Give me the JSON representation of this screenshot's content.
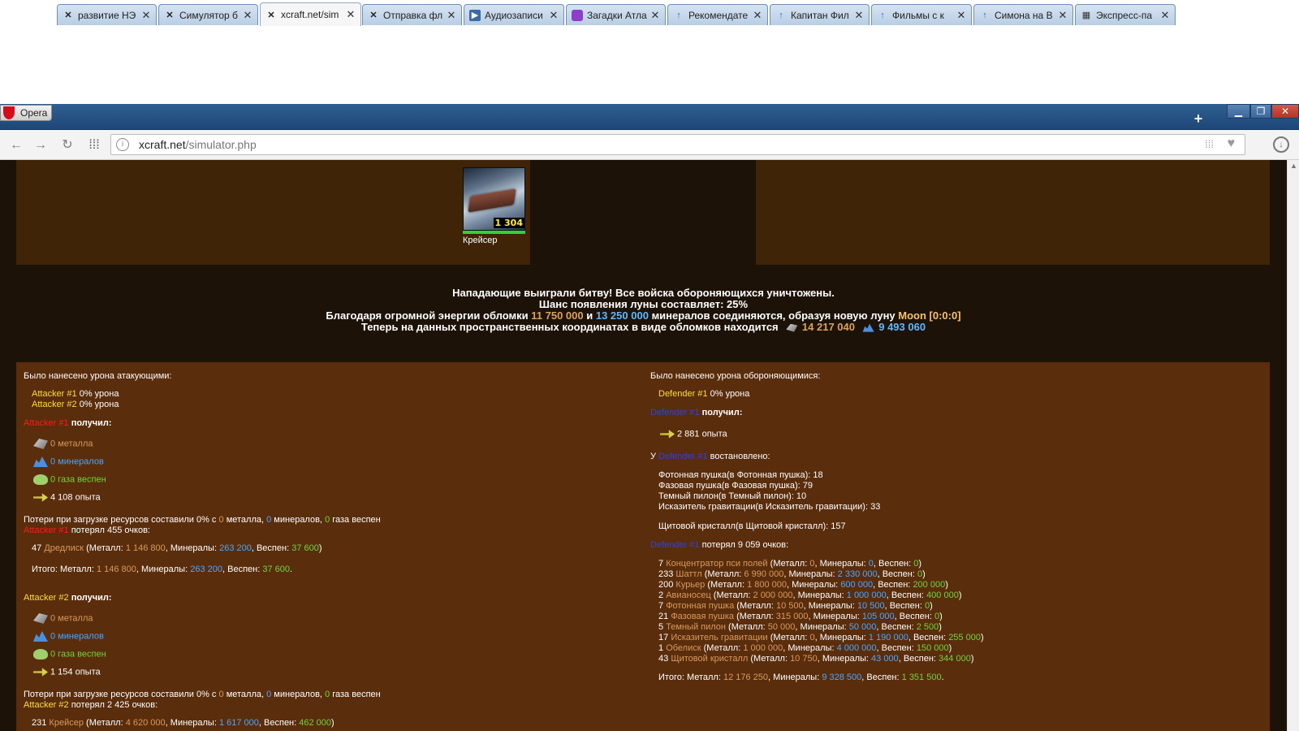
{
  "browser": {
    "opera_label": "Opera",
    "tabs": [
      {
        "label": "развитие НЭ",
        "icon": "xcraft-icon"
      },
      {
        "label": "Симулятор б",
        "icon": "xcraft-icon"
      },
      {
        "label": "xcraft.net/sim",
        "icon": "xcraft-icon",
        "active": true
      },
      {
        "label": "Отправка фл",
        "icon": "xcraft-icon"
      },
      {
        "label": "Аудиозаписи",
        "icon": "vk-icon"
      },
      {
        "label": "Загадки Атла",
        "icon": "purple-app-icon"
      },
      {
        "label": "Рекомендате",
        "icon": "arrow-up-icon"
      },
      {
        "label": "Капитан Фил",
        "icon": "arrow-up-icon"
      },
      {
        "label": "Фильмы с к",
        "icon": "arrow-up-icon"
      },
      {
        "label": "Симона на В",
        "icon": "arrow-up-icon"
      },
      {
        "label": "Экспресс-па",
        "icon": "grid-icon"
      }
    ],
    "url_host": "xcraft.net",
    "url_path": "/simulator.php"
  },
  "fleet": {
    "ship_count": "1 304",
    "ship_name": "Крейсер"
  },
  "battle": {
    "line1": "Нападающие выиграли битву! Все войска обороняющихся уничтожены.",
    "line2": "Шанс появления луны составляет: 25%",
    "line3_a": "Благодаря огромной энергии обломки",
    "line3_metal": "11 750 000",
    "line3_and": "и",
    "line3_crystal": "13 250 000",
    "line3_b": "минералов соединяются, образуя новую луну",
    "line3_moon": "Moon [0:0:0]",
    "line4_a": "Теперь на данных пространственных координатах в виде обломков находится",
    "line4_metal": "14 217 040",
    "line4_crystal": "9 493 060"
  },
  "left": {
    "damage_title": "Было нанесено урона атакующими:",
    "a1_name": "Attacker #1",
    "a1_dmg": "0% урона",
    "a2_name": "Attacker #2",
    "a2_dmg": "0% урона",
    "received": "получил:",
    "a1_metal": "0 металла",
    "a1_crystal": "0 минералов",
    "a1_gas": "0 газа веспен",
    "a1_exp": "4 108 опыта",
    "loss_a": "Потери при загрузке ресурсов составили 0% с",
    "loss_metal": "0",
    "loss_metal_lbl": "металла,",
    "loss_crystal": "0",
    "loss_crystal_lbl": "минералов,",
    "loss_gas": "0",
    "loss_gas_lbl": "газа веспен",
    "a1_lost": "потерял 455 очков:",
    "a1_unit_count": "47",
    "a1_unit_name": "Дредлиск",
    "a1_unit_metal": "1 146 800",
    "a1_unit_crystal": "263 200",
    "a1_unit_gas": "37 600",
    "total_lbl": "Итого: Металл:",
    "a1_total_metal": "1 146 800",
    "a1_total_crystal": "263 200",
    "a1_total_gas": "37 600",
    "a2_metal": "0 металла",
    "a2_crystal": "0 минералов",
    "a2_gas": "0 газа веспен",
    "a2_exp": "1 154 опыта",
    "a2_lost": "потерял 2 425 очков:",
    "a2_unit_count": "231",
    "a2_unit_name": "Крейсер",
    "a2_unit_metal": "4 620 000",
    "a2_unit_crystal": "1 617 000",
    "a2_unit_gas": "462 000",
    "minerals_lbl": "Минералы:",
    "vespen_lbl": "Веспен:",
    "metal_lbl": "Металл:"
  },
  "right": {
    "damage_title": "Было нанесено урона обороняющимися:",
    "d1_name": "Defender #1",
    "d1_dmg": "0% урона",
    "received": "получил:",
    "d1_exp": "2 881 опыта",
    "restored_prefix": "У",
    "restored_suffix": "востановлено:",
    "restored": [
      "Фотонная пушка(в Фотонная пушка): 18",
      "Фазовая пушка(в Фазовая пушка): 79",
      "Темный пилон(в Темный пилон): 10",
      "Исказитель гравитации(в Исказитель гравитации): 33"
    ],
    "restored_shield": "Щитовой кристалл(в Щитовой кристалл): 157",
    "d1_lost": "потерял 9 059 очков:",
    "units": [
      {
        "n": "7",
        "name": "Концентратор пси полей",
        "m": "0",
        "c": "0",
        "g": "0"
      },
      {
        "n": "233",
        "name": "Шаттл",
        "m": "6 990 000",
        "c": "2 330 000",
        "g": "0"
      },
      {
        "n": "200",
        "name": "Курьер",
        "m": "1 800 000",
        "c": "600 000",
        "g": "200 000"
      },
      {
        "n": "2",
        "name": "Авианосец",
        "m": "2 000 000",
        "c": "1 000 000",
        "g": "400 000"
      },
      {
        "n": "7",
        "name": "Фотонная пушка",
        "m": "10 500",
        "c": "10 500",
        "g": "0"
      },
      {
        "n": "21",
        "name": "Фазовая пушка",
        "m": "315 000",
        "c": "105 000",
        "g": "0"
      },
      {
        "n": "5",
        "name": "Темный пилон",
        "m": "50 000",
        "c": "50 000",
        "g": "2 500"
      },
      {
        "n": "17",
        "name": "Исказитель гравитации",
        "m": "0",
        "c": "1 190 000",
        "g": "255 000"
      },
      {
        "n": "1",
        "name": "Обелиск",
        "m": "1 000 000",
        "c": "4 000 000",
        "g": "150 000"
      },
      {
        "n": "43",
        "name": "Щитовой кристалл",
        "m": "10 750",
        "c": "43 000",
        "g": "344 000"
      }
    ],
    "total_metal": "12 176 250",
    "total_crystal": "9 328 500",
    "total_gas": "1 351 500"
  }
}
